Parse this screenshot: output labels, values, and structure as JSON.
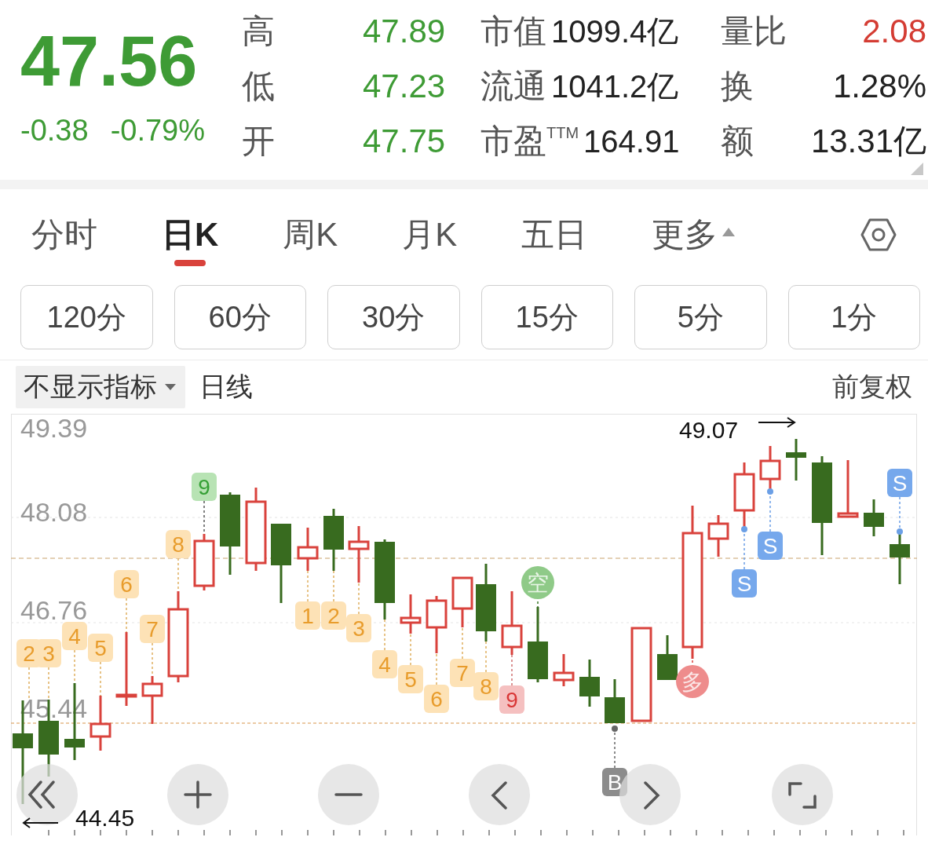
{
  "quote": {
    "price": "47.56",
    "change": "-0.38",
    "change_pct": "-0.79%"
  },
  "prices": [
    {
      "label": "高",
      "value": "47.89"
    },
    {
      "label": "低",
      "value": "47.23"
    },
    {
      "label": "开",
      "value": "47.75"
    }
  ],
  "metrics": [
    {
      "label": "市值",
      "value": "1099.4亿"
    },
    {
      "label": "流通",
      "value": "1041.2亿"
    },
    {
      "label": "市盈$^{TTM}$",
      "value": "164.91"
    }
  ],
  "ratios": [
    {
      "label": "量比",
      "value": "2.08",
      "color": "#d43c33"
    },
    {
      "label": "换",
      "value": "1.28%",
      "color": "#222222"
    },
    {
      "label": "额",
      "value": "13.31亿",
      "color": "#222222"
    }
  ],
  "tabs": [
    {
      "label": "分时",
      "kind": "tab",
      "selected": false
    },
    {
      "label": "日K",
      "kind": "tab",
      "selected": true
    },
    {
      "label": "周K",
      "kind": "tab",
      "selected": false
    },
    {
      "label": "月K",
      "kind": "tab",
      "selected": false
    },
    {
      "label": "五日",
      "kind": "tab",
      "selected": false
    },
    {
      "label": "更多",
      "kind": "menu",
      "selected": false
    }
  ],
  "periods": [
    "120分",
    "60分",
    "30分",
    "15分",
    "5分",
    "1分"
  ],
  "indicator": {
    "dropdown": "不显示指标",
    "line": "日线",
    "adjust": "前复权"
  },
  "chart": {
    "y_labels": [
      "49.39",
      "48.08",
      "46.76",
      "45.44"
    ],
    "high_label": "49.07",
    "low_label": "44.45",
    "markers": [
      {
        "kind": "count",
        "text": "2"
      },
      {
        "kind": "count",
        "text": "3"
      },
      {
        "kind": "count",
        "text": "4"
      },
      {
        "kind": "count",
        "text": "5"
      },
      {
        "kind": "count",
        "text": "6"
      },
      {
        "kind": "count",
        "text": "7"
      },
      {
        "kind": "count",
        "text": "8"
      },
      {
        "kind": "count-green",
        "text": "9"
      },
      {
        "kind": "count",
        "text": "1"
      },
      {
        "kind": "count",
        "text": "2"
      },
      {
        "kind": "count",
        "text": "3"
      },
      {
        "kind": "count",
        "text": "4"
      },
      {
        "kind": "count",
        "text": "5"
      },
      {
        "kind": "count",
        "text": "6"
      },
      {
        "kind": "count",
        "text": "7"
      },
      {
        "kind": "count",
        "text": "8"
      },
      {
        "kind": "count-red",
        "text": "9"
      },
      {
        "kind": "short",
        "text": "空"
      },
      {
        "kind": "long",
        "text": "多"
      },
      {
        "kind": "sell",
        "text": "S"
      },
      {
        "kind": "sell",
        "text": "S"
      },
      {
        "kind": "sell",
        "text": "S"
      },
      {
        "kind": "buy",
        "text": "B"
      }
    ]
  }
}
